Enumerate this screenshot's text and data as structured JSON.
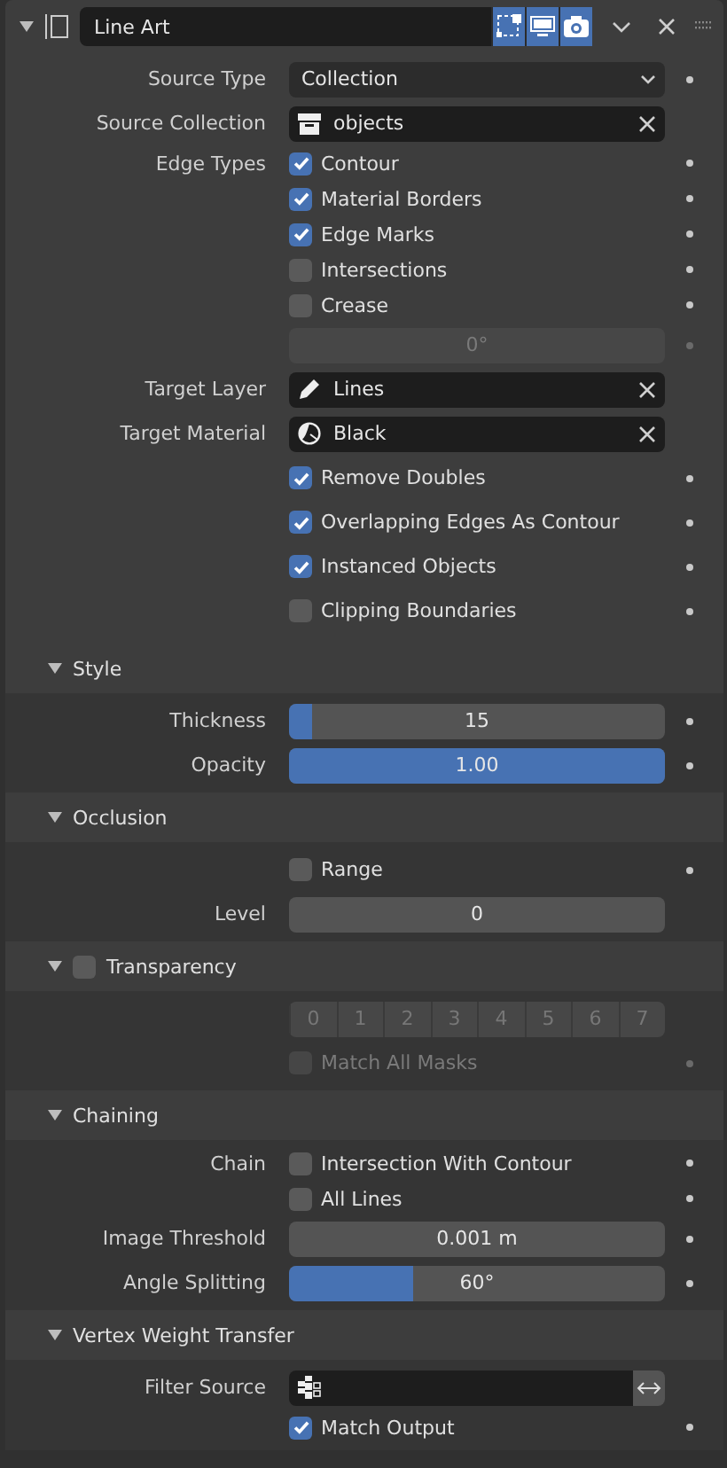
{
  "header": {
    "expanded": true,
    "name": "Line Art",
    "toggles": [
      {
        "kind": "editmode",
        "on": true
      },
      {
        "kind": "viewport",
        "on": true
      },
      {
        "kind": "render",
        "on": true
      }
    ]
  },
  "main": [
    {
      "kind": "dropdown",
      "label": "Source Type",
      "value": "Collection",
      "dot": true
    },
    {
      "kind": "collection",
      "label": "Source Collection",
      "value": "objects",
      "dot": false
    },
    {
      "kind": "check",
      "label": "Edge Types",
      "text": "Contour",
      "checked": true,
      "disabled": false,
      "compact": true,
      "dot": true
    },
    {
      "kind": "check",
      "text": "Material Borders",
      "checked": true,
      "disabled": false,
      "compact": true,
      "dot": true
    },
    {
      "kind": "check",
      "text": "Edge Marks",
      "checked": true,
      "disabled": false,
      "compact": true,
      "dot": true
    },
    {
      "kind": "check",
      "text": "Intersections",
      "checked": false,
      "disabled": false,
      "compact": true,
      "dot": true
    },
    {
      "kind": "check",
      "text": "Crease",
      "checked": false,
      "disabled": false,
      "compact": true,
      "dot": true
    },
    {
      "kind": "number",
      "value": "0°",
      "disabled": true,
      "dot": true
    },
    {
      "kind": "layer",
      "label": "Target Layer",
      "value": "Lines",
      "dot": false
    },
    {
      "kind": "material",
      "label": "Target Material",
      "value": "Black",
      "dot": false
    },
    {
      "kind": "check",
      "text": "Remove Doubles",
      "checked": true,
      "disabled": false,
      "compact": false,
      "dot": true
    },
    {
      "kind": "check",
      "text": "Overlapping Edges As Contour",
      "checked": true,
      "disabled": false,
      "compact": false,
      "dot": true
    },
    {
      "kind": "check",
      "text": "Instanced Objects",
      "checked": true,
      "disabled": false,
      "compact": false,
      "dot": true
    },
    {
      "kind": "check",
      "text": "Clipping Boundaries",
      "checked": false,
      "disabled": false,
      "compact": false,
      "dot": true
    }
  ],
  "panels": [
    {
      "title": "Style",
      "expanded": true,
      "rows": [
        {
          "kind": "number",
          "label": "Thickness",
          "value": "15",
          "level": 0.06,
          "disabled": false,
          "dot": true
        },
        {
          "kind": "number",
          "label": "Opacity",
          "value": "1.00",
          "level": 1,
          "disabled": false,
          "dot": true
        }
      ]
    },
    {
      "title": "Occlusion",
      "expanded": true,
      "rows": [
        {
          "kind": "check",
          "text": "Range",
          "checked": false,
          "disabled": false,
          "compact": false,
          "dot": true
        },
        {
          "kind": "number",
          "label": "Level",
          "value": "0",
          "disabled": false,
          "dot": false
        }
      ]
    },
    {
      "title": "Transparency",
      "expanded": true,
      "checkbox": {
        "checked": false
      },
      "rows": [
        {
          "kind": "masks",
          "items": [
            "0",
            "1",
            "2",
            "3",
            "4",
            "5",
            "6",
            "7"
          ],
          "disabled": true
        },
        {
          "kind": "check",
          "text": "Match All Masks",
          "checked": false,
          "disabled": true,
          "compact": false,
          "dot": true
        }
      ]
    },
    {
      "title": "Chaining",
      "expanded": true,
      "rows": [
        {
          "kind": "check",
          "label": "Chain",
          "text": "Intersection With Contour",
          "checked": false,
          "disabled": false,
          "compact": true,
          "dot": true
        },
        {
          "kind": "check",
          "text": "All Lines",
          "checked": false,
          "disabled": false,
          "compact": true,
          "dot": true
        },
        {
          "kind": "number",
          "label": "Image Threshold",
          "value": "0.001 m",
          "disabled": false,
          "dot": true
        },
        {
          "kind": "number",
          "label": "Angle Splitting",
          "value": "60°",
          "level": 0.33,
          "disabled": false,
          "dot": true
        }
      ]
    },
    {
      "title": "Vertex Weight Transfer",
      "expanded": true,
      "rows": [
        {
          "kind": "vgroup",
          "label": "Filter Source",
          "dot": false
        },
        {
          "kind": "check",
          "text": "Match Output",
          "checked": true,
          "disabled": false,
          "compact": true,
          "dot": true
        }
      ]
    }
  ]
}
